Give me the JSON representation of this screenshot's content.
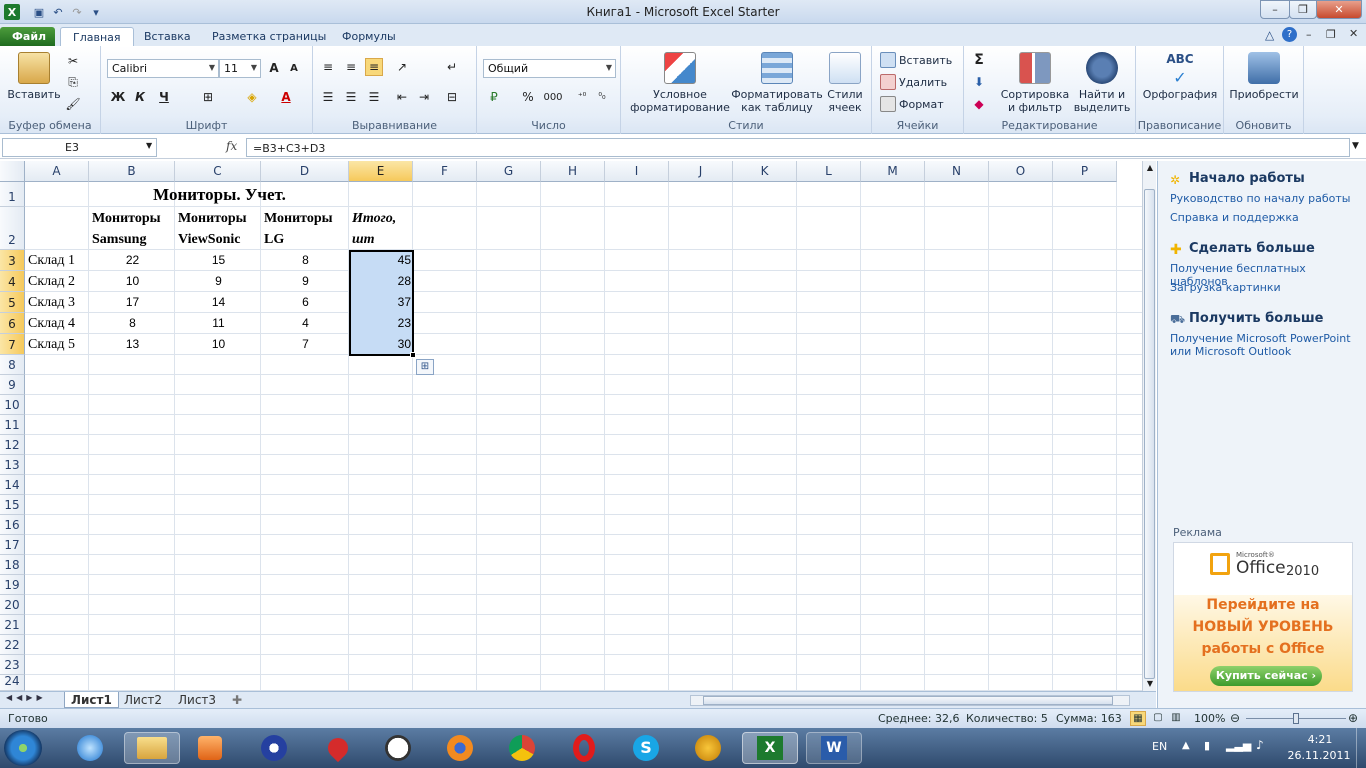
{
  "window": {
    "title": "Книга1 - Microsoft Excel Starter"
  },
  "tabs": [
    "Файл",
    "Главная",
    "Вставка",
    "Разметка страницы",
    "Формулы"
  ],
  "ribbon": {
    "clipboard": {
      "paste": "Вставить",
      "label": "Буфер обмена"
    },
    "font": {
      "name": "Calibri",
      "size": "11",
      "label": "Шрифт",
      "bold": "Ж",
      "italic": "К",
      "underline": "Ч"
    },
    "alignment": {
      "label": "Выравнивание"
    },
    "number": {
      "format": "Общий",
      "label": "Число",
      "percent": "%",
      "thousands": "000"
    },
    "styles": {
      "conditional": "Условное форматирование",
      "as_table": "Форматировать как таблицу",
      "cell_styles": "Стили ячеек",
      "label": "Стили"
    },
    "cells": {
      "insert": "Вставить",
      "delete": "Удалить",
      "format": "Формат",
      "label": "Ячейки"
    },
    "editing": {
      "sigma": "Σ",
      "sort": "Сортировка и фильтр",
      "find": "Найти и выделить",
      "label": "Редактирование"
    },
    "proofing": {
      "spelling": "Орфография",
      "abc": "ABC",
      "label": "Правописание"
    },
    "update": {
      "updates": "Приобрести",
      "label": "Обновить"
    }
  },
  "formula_bar": {
    "name_box": "E3",
    "fx": "fx",
    "formula": "=B3+C3+D3"
  },
  "columns": [
    "A",
    "B",
    "C",
    "D",
    "E",
    "F",
    "G",
    "H",
    "I",
    "J",
    "K",
    "L",
    "M",
    "N",
    "O",
    "P"
  ],
  "rows": [
    "1",
    "2",
    "3",
    "4",
    "5",
    "6",
    "7",
    "8",
    "9",
    "10",
    "11",
    "12",
    "13",
    "14",
    "15",
    "16",
    "17",
    "18",
    "19",
    "20",
    "21",
    "22",
    "23",
    "24"
  ],
  "sheet": {
    "title": "Мониторы. Учет.",
    "headers": [
      "Мониторы Samsung",
      "Мониторы ViewSonic",
      "Мониторы LG",
      "Итого, шт"
    ],
    "data": [
      {
        "label": "Склад 1",
        "b": "22",
        "c": "15",
        "d": "8",
        "e": "45"
      },
      {
        "label": "Склад 2",
        "b": "10",
        "c": "9",
        "d": "9",
        "e": "28"
      },
      {
        "label": "Склад 3",
        "b": "17",
        "c": "14",
        "d": "6",
        "e": "37"
      },
      {
        "label": "Склад 4",
        "b": "8",
        "c": "11",
        "d": "4",
        "e": "23"
      },
      {
        "label": "Склад 5",
        "b": "13",
        "c": "10",
        "d": "7",
        "e": "30"
      }
    ]
  },
  "sheet_tabs": [
    "Лист1",
    "Лист2",
    "Лист3"
  ],
  "task_pane": {
    "section1": {
      "title": "Начало работы",
      "links": [
        "Руководство по началу работы",
        "Справка и поддержка"
      ]
    },
    "section2": {
      "title": "Сделать больше",
      "links": [
        "Получение бесплатных шаблонов",
        "Загрузка картинки"
      ]
    },
    "section3": {
      "title": "Получить больше",
      "links": [
        "Получение Microsoft PowerPoint или Microsoft Outlook"
      ]
    },
    "ad_label": "Реклама",
    "ad": {
      "brand_small": "Microsoft®",
      "brand": "Office",
      "year": "2010",
      "line1": "Перейдите на",
      "line2": "НОВЫЙ УРОВЕНЬ",
      "line3": "работы с Office",
      "button": "Купить сейчас ›"
    }
  },
  "status": {
    "ready": "Готово",
    "average": "Среднее: 32,6",
    "count": "Количество: 5",
    "sum": "Сумма: 163",
    "zoom": "100%"
  },
  "taskbar": {
    "lang": "EN",
    "time": "4:21",
    "date": "26.11.2011"
  },
  "colors": {
    "accent": "#1f5ba6",
    "selection": "#c6dcf5",
    "header_selected": "#f6c95b",
    "file_tab": "#2f6b2f"
  }
}
